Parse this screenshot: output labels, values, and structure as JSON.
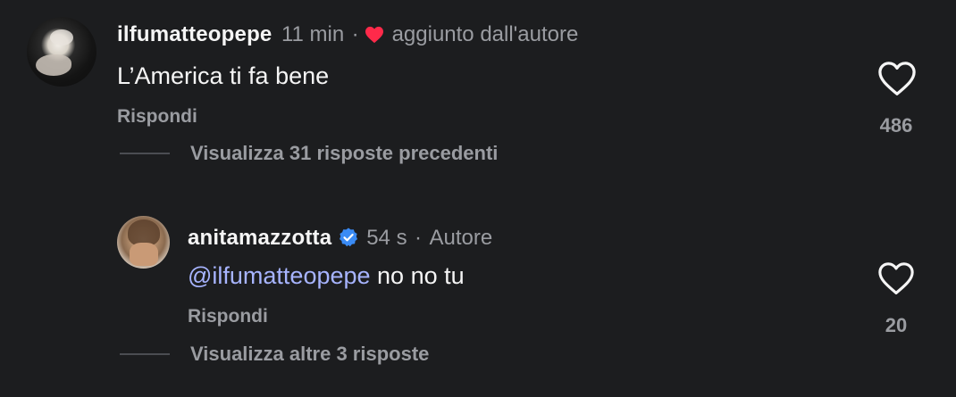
{
  "comment": {
    "username": "ilfumatteopepe",
    "time": "11 min",
    "separator": "·",
    "liked_by_author_label": "aggiunto dall'autore",
    "text": "L’America ti fa bene",
    "reply_label": "Rispondi",
    "like_count": "486",
    "view_previous_replies": "Visualizza 31 risposte precedenti"
  },
  "reply": {
    "username": "anitamazzotta",
    "time": "54 s",
    "separator": "·",
    "author_badge": "Autore",
    "mention": "@ilfumatteopepe",
    "text": " no no tu",
    "reply_label": "Rispondi",
    "like_count": "20",
    "view_more_replies": "Visualizza altre 3 risposte"
  },
  "colors": {
    "background": "#1c1d1f",
    "primary_text": "#f5f5f5",
    "secondary_text": "#9a9ca1",
    "mention": "#a7b4ff",
    "heart_red": "#ff2a4a",
    "verified_blue": "#3a8bf5"
  },
  "icons": {
    "like": "heart-outline-icon",
    "author_liked": "heart-filled-icon",
    "verified": "verified-badge-icon"
  }
}
